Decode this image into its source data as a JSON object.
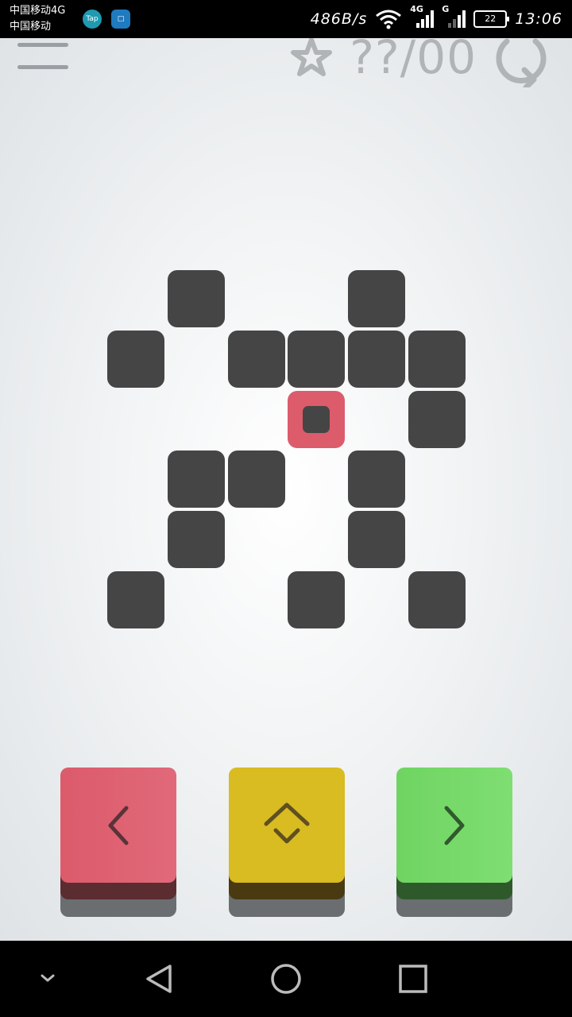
{
  "status_bar": {
    "carrier_1": "中国移动4G",
    "carrier_2": "中国移动",
    "app_icon_1": "Tap",
    "app_icon_2": "□",
    "net_speed": "486B/s",
    "net_label_1": "4G",
    "net_label_2": "G",
    "battery": "22",
    "time": "13:06"
  },
  "game": {
    "score": "??/00",
    "icons": [
      "menu-icon",
      "star-icon",
      "restart-icon"
    ],
    "colors": {
      "block": "#454545",
      "player": "#dc5c6c",
      "left_button": "#dc5b6b",
      "jump_button": "#d9bb22",
      "right_button": "#6fd462",
      "score_text": "#b0b4b7"
    },
    "board": {
      "player": {
        "col": 3,
        "row": 2
      },
      "blocks": [
        {
          "col": 1,
          "row": 0
        },
        {
          "col": 4,
          "row": 0
        },
        {
          "col": 0,
          "row": 1
        },
        {
          "col": 2,
          "row": 1
        },
        {
          "col": 3,
          "row": 1
        },
        {
          "col": 4,
          "row": 1
        },
        {
          "col": 5,
          "row": 1
        },
        {
          "col": 5,
          "row": 2
        },
        {
          "col": 1,
          "row": 3
        },
        {
          "col": 2,
          "row": 3
        },
        {
          "col": 4,
          "row": 3
        },
        {
          "col": 1,
          "row": 4
        },
        {
          "col": 4,
          "row": 4
        },
        {
          "col": 0,
          "row": 5
        },
        {
          "col": 3,
          "row": 5
        },
        {
          "col": 5,
          "row": 5
        }
      ]
    },
    "controls": [
      {
        "name": "move-left-button",
        "icon": "chevron-left-icon"
      },
      {
        "name": "jump-button",
        "icon": "jump-diamond-icon"
      },
      {
        "name": "move-right-button",
        "icon": "chevron-right-icon"
      }
    ]
  },
  "nav_bar": {
    "icons": [
      "collapse-icon",
      "back-icon",
      "home-icon",
      "recents-icon"
    ]
  }
}
